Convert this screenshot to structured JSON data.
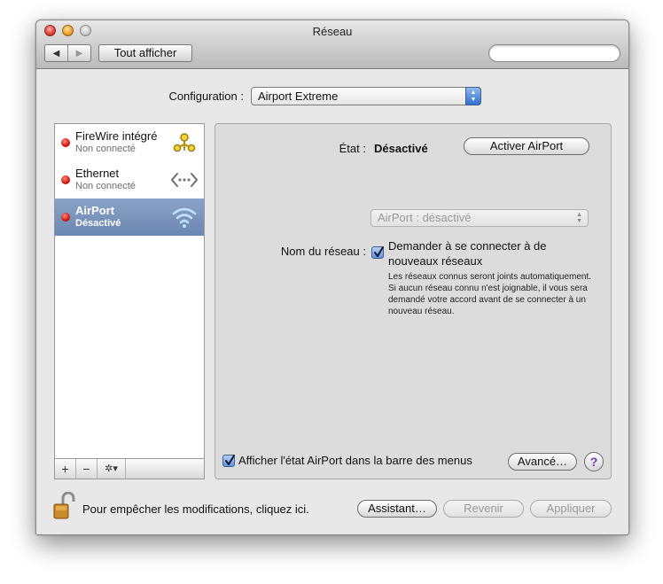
{
  "window": {
    "title": "Réseau"
  },
  "toolbar": {
    "back_glyph": "◀",
    "forward_glyph": "▶",
    "show_all_label": "Tout afficher",
    "search_value": ""
  },
  "config": {
    "label": "Configuration :",
    "value": "Airport Extreme"
  },
  "services": [
    {
      "name": "FireWire intégré",
      "status": "Non connecté",
      "icon": "firewire-icon",
      "selected": false
    },
    {
      "name": "Ethernet",
      "status": "Non connecté",
      "icon": "ethernet-icon",
      "selected": false
    },
    {
      "name": "AirPort",
      "status": "Désactivé",
      "icon": "airport-icon",
      "selected": true
    }
  ],
  "sidebar_bar": {
    "add": "+",
    "remove": "−",
    "gear": "✲▾"
  },
  "panel": {
    "status_label": "État :",
    "status_value": "Désactivé",
    "toggle_button": "Activer AirPort",
    "network_popup": "AirPort : désactivé",
    "network_label": "Nom du réseau :",
    "ask_label": "Demander à se connecter à de nouveaux réseaux",
    "ask_checked": true,
    "ask_description": "Les réseaux connus seront joints automatiquement. Si aucun réseau connu n'est joignable, il vous sera demandé votre accord avant de se connecter à un nouveau réseau.",
    "menubar_label": "Afficher l'état AirPort dans la barre des menus",
    "menubar_checked": true,
    "advanced_button": "Avancé…",
    "help_glyph": "?"
  },
  "footer": {
    "lock_text": "Pour empêcher les modifications, cliquez ici.",
    "assistant_button": "Assistant…",
    "revert_button": "Revenir",
    "apply_button": "Appliquer"
  },
  "colors": {
    "selection": "#7890b8",
    "status_red": "#d0160c",
    "accent_blue": "#2e6fd0"
  }
}
